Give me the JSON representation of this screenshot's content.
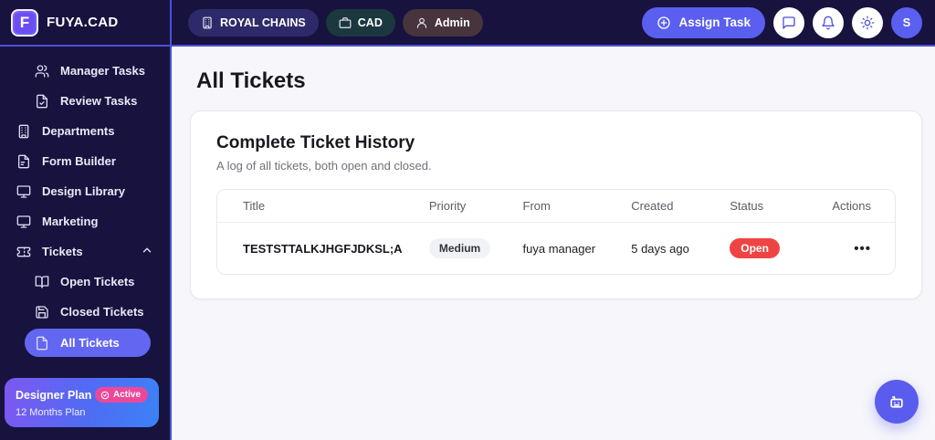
{
  "brand": {
    "name": "FUYA.CAD",
    "logo_letter": "F"
  },
  "topbar": {
    "org_badge": "ROYAL CHAINS",
    "workspace_badge": "CAD",
    "role_badge": "Admin",
    "assign_task_label": "Assign Task",
    "avatar_initial": "S"
  },
  "sidebar": {
    "items": [
      {
        "label": "Manager Tasks"
      },
      {
        "label": "Review Tasks"
      },
      {
        "label": "Departments"
      },
      {
        "label": "Form Builder"
      },
      {
        "label": "Design Library"
      },
      {
        "label": "Marketing"
      },
      {
        "label": "Tickets"
      },
      {
        "label": "Open Tickets"
      },
      {
        "label": "Closed Tickets"
      },
      {
        "label": "All Tickets"
      }
    ],
    "plan": {
      "title": "Designer Plan",
      "badge": "Active",
      "subtitle": "12 Months Plan"
    }
  },
  "main": {
    "page_title": "All Tickets",
    "card": {
      "title": "Complete Ticket History",
      "subtitle": "A log of all tickets, both open and closed."
    },
    "table": {
      "headers": [
        "Title",
        "Priority",
        "From",
        "Created",
        "Status",
        "Actions"
      ],
      "rows": [
        {
          "title": "TESTSTTALKJHGFJDKSL;A",
          "priority": "Medium",
          "from": "fuya manager",
          "created": "5 days ago",
          "status": "Open",
          "more_glyph": "•••"
        }
      ]
    }
  },
  "colors": {
    "sidebar_bg": "#18123f",
    "accent_border": "#4c51d6",
    "primary": "#6366f1",
    "open_badge": "#ef4444",
    "active_badge": "#ec4899",
    "plan_gradient_start": "#7e57f0",
    "plan_gradient_end": "#3b82f6"
  }
}
